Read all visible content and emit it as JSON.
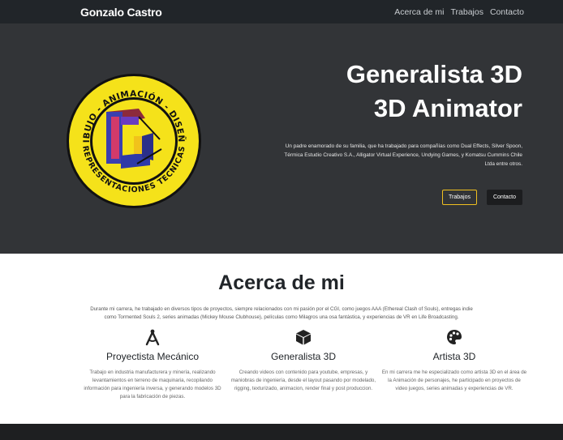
{
  "navbar": {
    "brand": "Gonzalo Castro",
    "links": [
      "Acerca de mi",
      "Trabajos",
      "Contacto"
    ]
  },
  "hero": {
    "logo": {
      "top_text": "DIBUJO - ANIMACIÓN - DISEÑO",
      "bottom_text": "REPRESENTACIONES TECNICAS",
      "letter": "G"
    },
    "title_line1": "Generalista 3D",
    "title_line2": "3D Animator",
    "description": "Un padre enamorado de su familia, que ha trabajado para compañías como Dual Effects, Silver Spoon, Térmica Estudio Creativo S.A., Alligator Virtual Experience, Undying Games, y Komatsu Cummins Chile Ltda entre otros.",
    "button_works": "Trabajos",
    "button_contact": "Contacto"
  },
  "about": {
    "heading": "Acerca de mi",
    "text": "Durante mi carrera, he trabajado en diversos tipos de proyectos, siempre relacionados con mi pasión por el CGI, como juegos AAA (Ethereal Clash of Souls), entregas indie como Tormented Souls 2, series animadas (Mickey Mouse Clubhouse), películas como Milagros una osa fantástica, y experiencias de VR en Life Broadcasting.",
    "services": [
      {
        "icon": "compass-drafting-icon",
        "title": "Proyectista Mecánico",
        "text": "Trabajo en industria manufacturera y minería, realizando levantamientos en terreno de maquinaria, recopilando información para ingeniería inversa, y generando modelos 3D para la fabricación de piezas."
      },
      {
        "icon": "cube-icon",
        "title": "Generalista 3D",
        "text": "Creando videos con contenido para youtube, empresas, y maniobras de ingeniería, desde el layout pasando por modelado, rigging, texturizado, animacion, render final y post produccion."
      },
      {
        "icon": "palette-icon",
        "title": "Artista 3D",
        "text": "En mi carrera me he especializado como artista 3D en el área de la Animación de personajes, he participado en proyectos de video juegos, series animadas y experiencias de VR."
      }
    ]
  },
  "colors": {
    "navbar": "#212529",
    "hero": "#323437",
    "accent": "#f0c020",
    "logo_yellow": "#f5e21a"
  }
}
